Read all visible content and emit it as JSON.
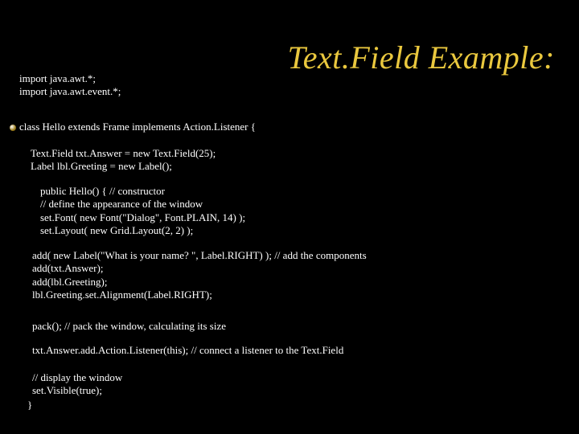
{
  "title": "Text.Field Example:",
  "imports": {
    "l1": "import java.awt.*;",
    "l2": "import java.awt.event.*;"
  },
  "classLine": "class Hello extends Frame implements Action.Listener {",
  "blockA": {
    "l1": "Text.Field txt.Answer = new Text.Field(25);",
    "l2": "Label lbl.Greeting = new Label();"
  },
  "blockB": {
    "l1": "public Hello() { // constructor",
    "l2": "// define the appearance of the window",
    "l3": "set.Font( new Font(\"Dialog\", Font.PLAIN, 14) );",
    "l4": "set.Layout( new Grid.Layout(2, 2) );"
  },
  "blockC": {
    "l1": "add( new Label(\"What is your name? \", Label.RIGHT) ); // add the components",
    "l2": " add(txt.Answer);",
    "l3": " add(lbl.Greeting);",
    "l4": " lbl.Greeting.set.Alignment(Label.RIGHT);"
  },
  "blockD": "pack(); // pack the window, calculating its size",
  "blockE": "txt.Answer.add.Action.Listener(this); // connect a listener to the Text.Field",
  "blockF": {
    "l1": "// display the window",
    "l2": "set.Visible(true);"
  },
  "closeBrace": "}"
}
